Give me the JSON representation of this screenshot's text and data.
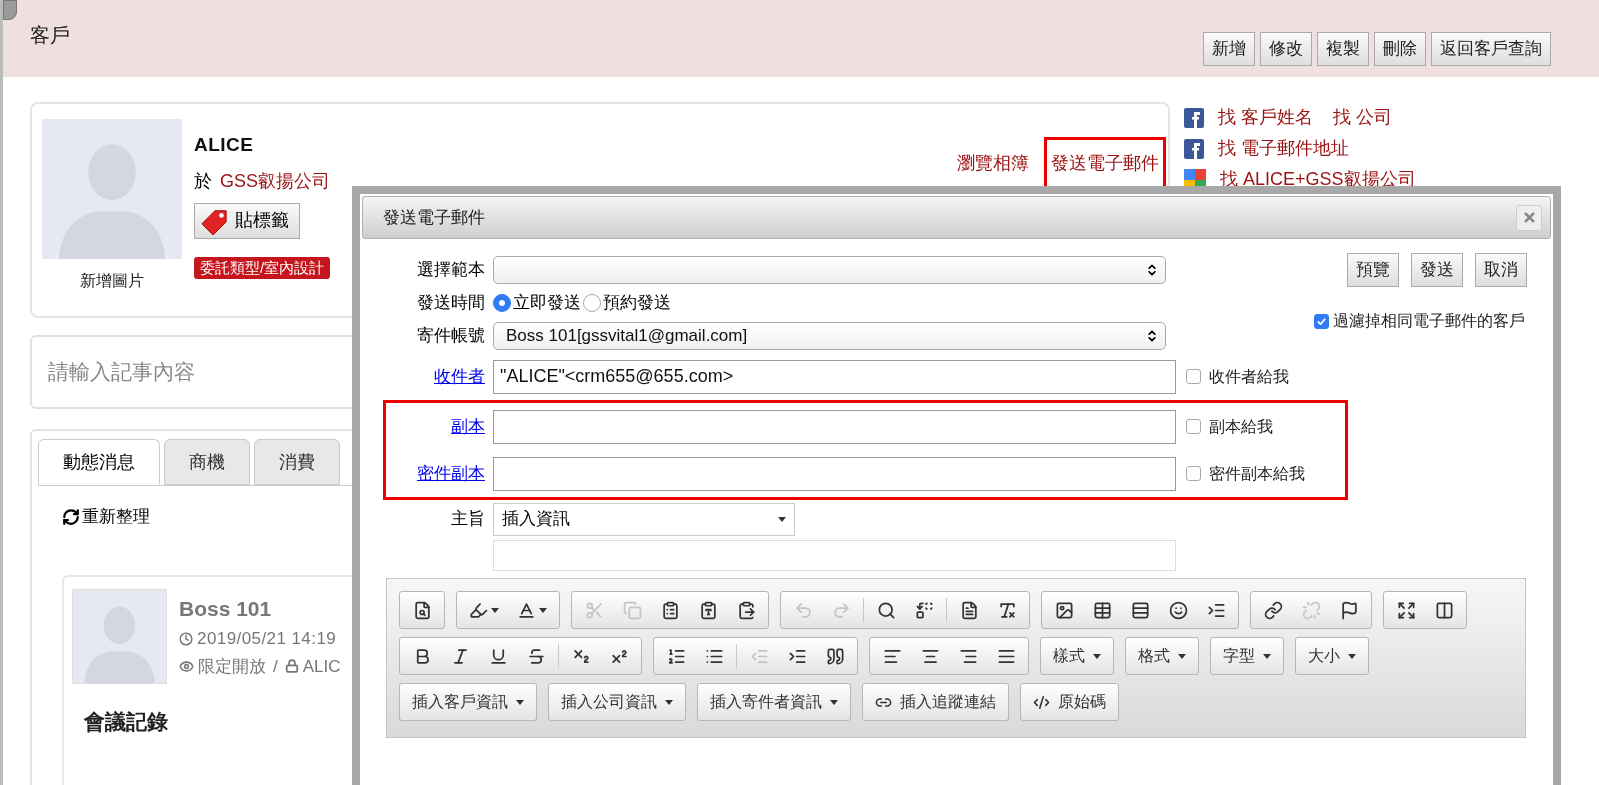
{
  "header": {
    "title": "客戶",
    "buttons": [
      "新增",
      "修改",
      "複製",
      "刪除",
      "返回客戶查詢"
    ]
  },
  "profile": {
    "add_photo": "新增圖片",
    "name": "ALICE",
    "company_prefix": "於",
    "company": "GSS叡揚公司",
    "tag_button": "貼標籤",
    "tag": "委託類型/室內設計",
    "links": [
      {
        "label": "瀏覽相簿",
        "highlighted": false
      },
      {
        "label": "發送電子郵件",
        "highlighted": true
      }
    ]
  },
  "search_links": [
    {
      "kind": "facebook",
      "items": [
        "找 客戶姓名",
        "找 公司"
      ]
    },
    {
      "kind": "facebook",
      "items": [
        "找 電子郵件地址"
      ]
    },
    {
      "kind": "google",
      "items": [
        "找 ALICE+GSS叡揚公司"
      ]
    }
  ],
  "note_field": {
    "placeholder": "請輸入記事內容"
  },
  "tabs": [
    {
      "label": "動態消息",
      "selected": true
    },
    {
      "label": "商機",
      "selected": false
    },
    {
      "label": "消費",
      "selected": false
    }
  ],
  "refresh": "重新整理",
  "post": {
    "author": "Boss 101",
    "time": "2019/05/21 14:19",
    "visibility": "限定開放",
    "separator": "/",
    "owner": "ALIC",
    "title": "會議記錄"
  },
  "email_dialog": {
    "title": "發送電子郵件",
    "template": {
      "label": "選擇範本"
    },
    "send_time": {
      "label": "發送時間",
      "options": [
        {
          "label": "立即發送",
          "selected": true
        },
        {
          "label": "預約發送",
          "selected": false
        }
      ]
    },
    "account": {
      "label": "寄件帳號",
      "value": "Boss 101[gssvital1@gmail.com]"
    },
    "recipients": [
      {
        "label": "收件者",
        "value": "\"ALICE\"<crm655@655.com>",
        "self_copy": "收件者給我",
        "checked": false,
        "highlighted": false
      },
      {
        "label": "副本",
        "self_copy": "副本給我",
        "checked": false,
        "highlighted": true
      },
      {
        "label": "密件副本",
        "self_copy": "密件副本給我",
        "checked": false,
        "highlighted": true
      }
    ],
    "subject": {
      "label": "主旨",
      "insert": "插入資訊"
    },
    "actions": [
      "預覽",
      "發送",
      "取消"
    ],
    "filter": {
      "label": "過濾掉相同電子郵件的客戶",
      "checked": true
    },
    "toolbar": [
      [
        [
          {
            "kind": "icon",
            "disabled": false
          }
        ],
        [
          {
            "kind": "icon-menu",
            "disabled": false
          },
          {
            "kind": "icon-menu",
            "disabled": false
          }
        ],
        [
          {
            "kind": "icon",
            "disabled": true
          },
          {
            "kind": "icon",
            "disabled": true
          },
          {
            "kind": "icon",
            "disabled": false
          },
          {
            "kind": "icon",
            "disabled": false
          },
          {
            "kind": "icon",
            "disabled": false
          }
        ],
        [
          {
            "kind": "icon",
            "disabled": true
          },
          {
            "kind": "icon",
            "disabled": true
          },
          {
            "kind": "separator"
          },
          {
            "kind": "icon",
            "disabled": false
          },
          {
            "kind": "icon",
            "disabled": false
          },
          {
            "kind": "separator"
          },
          {
            "kind": "icon",
            "disabled": false
          },
          {
            "kind": "icon",
            "disabled": false
          }
        ],
        [
          {
            "kind": "icon",
            "disabled": false
          },
          {
            "kind": "icon",
            "disabled": false
          },
          {
            "kind": "icon",
            "disabled": false
          },
          {
            "kind": "icon",
            "disabled": false
          },
          {
            "kind": "icon",
            "disabled": false
          }
        ],
        [
          {
            "kind": "icon",
            "disabled": false
          },
          {
            "kind": "icon",
            "disabled": true
          },
          {
            "kind": "icon",
            "disabled": false
          }
        ],
        [
          {
            "kind": "icon",
            "disabled": false
          },
          {
            "kind": "icon",
            "disabled": false
          }
        ]
      ],
      [
        [
          {
            "kind": "icon",
            "disabled": false
          },
          {
            "kind": "icon",
            "disabled": false
          },
          {
            "kind": "icon",
            "disabled": false
          },
          {
            "kind": "icon",
            "disabled": false
          },
          {
            "kind": "separator"
          },
          {
            "kind": "icon",
            "disabled": false
          },
          {
            "kind": "icon",
            "disabled": false
          }
        ],
        [
          {
            "kind": "icon",
            "disabled": false
          },
          {
            "kind": "icon",
            "disabled": false
          },
          {
            "kind": "separator"
          },
          {
            "kind": "icon",
            "disabled": true
          },
          {
            "kind": "icon",
            "disabled": false
          },
          {
            "kind": "icon",
            "disabled": false
          }
        ],
        [
          {
            "kind": "icon",
            "disabled": false
          },
          {
            "kind": "icon",
            "disabled": false
          },
          {
            "kind": "icon",
            "disabled": false
          },
          {
            "kind": "icon",
            "disabled": false
          }
        ],
        [
          {
            "kind": "text-menu",
            "label": "樣式"
          }
        ],
        [
          {
            "kind": "text-menu",
            "label": "格式"
          }
        ],
        [
          {
            "kind": "text-menu",
            "label": "字型"
          }
        ],
        [
          {
            "kind": "text-menu",
            "label": "大小"
          }
        ]
      ],
      [
        [
          {
            "kind": "text-menu",
            "label": "插入客戶資訊"
          }
        ],
        [
          {
            "kind": "text-menu",
            "label": "插入公司資訊"
          }
        ],
        [
          {
            "kind": "text-menu",
            "label": "插入寄件者資訊"
          }
        ],
        [
          {
            "kind": "text-button",
            "label": "插入追蹤連結"
          }
        ],
        [
          {
            "kind": "text-button",
            "label": "原始碼"
          }
        ]
      ]
    ]
  }
}
